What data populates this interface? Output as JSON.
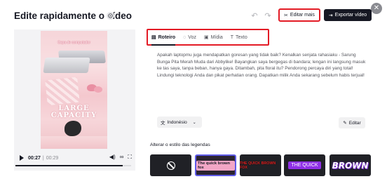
{
  "header": {
    "title": "Edite rapidamente o vídeo",
    "edit_more_label": "Editar mais",
    "export_label": "Exportar vídeo"
  },
  "video": {
    "caption": "Capa de computador",
    "overlay_line1": "LARGE",
    "overlay_line2": "CAPACITY",
    "current_time": "00:27",
    "separator": "|",
    "duration": "00:29",
    "progress_fraction": 0.93
  },
  "tabs": [
    {
      "label": "Roteiro",
      "icon": "script-icon",
      "active": true
    },
    {
      "label": "Voz",
      "icon": "microphone-icon",
      "active": false
    },
    {
      "label": "Mídia",
      "icon": "media-icon",
      "active": false
    },
    {
      "label": "Texto",
      "icon": "text-icon",
      "active": false
    }
  ],
  "script": {
    "text": "Apakah laptopmu juga mendapatkan goresan yang tidak baik? Kenalkan senjata rahasiaku - Sarung Bunga Pita Merah Muda dari Abbylike! Bayangkan saya bergegas di bandara; lengan ini langsung masuk ke tas saya, tanpa beban, hanya gaya. Ditambah, pita floral itu? Pendorong percaya diri yang total! Lindungi teknologi Anda dan pikat perhatian orang. Dapatkan milik Anda sekarang sebelum habis terjual!",
    "language": "Indonésio",
    "edit_label": "Editar"
  },
  "caption_styles": {
    "label": "Alterar o estilo das legendas",
    "options": [
      {
        "text": "",
        "icon": "none-icon"
      },
      {
        "text": "The quick brown fox",
        "selected": true
      },
      {
        "text": "THE QUICK BROWN FOX"
      },
      {
        "text": "THE QUICK"
      },
      {
        "text": "BROWN"
      }
    ]
  },
  "colors": {
    "highlight_border": "#e31b25",
    "primary_dark": "#161823",
    "selected_style_border": "#5f5be8"
  }
}
